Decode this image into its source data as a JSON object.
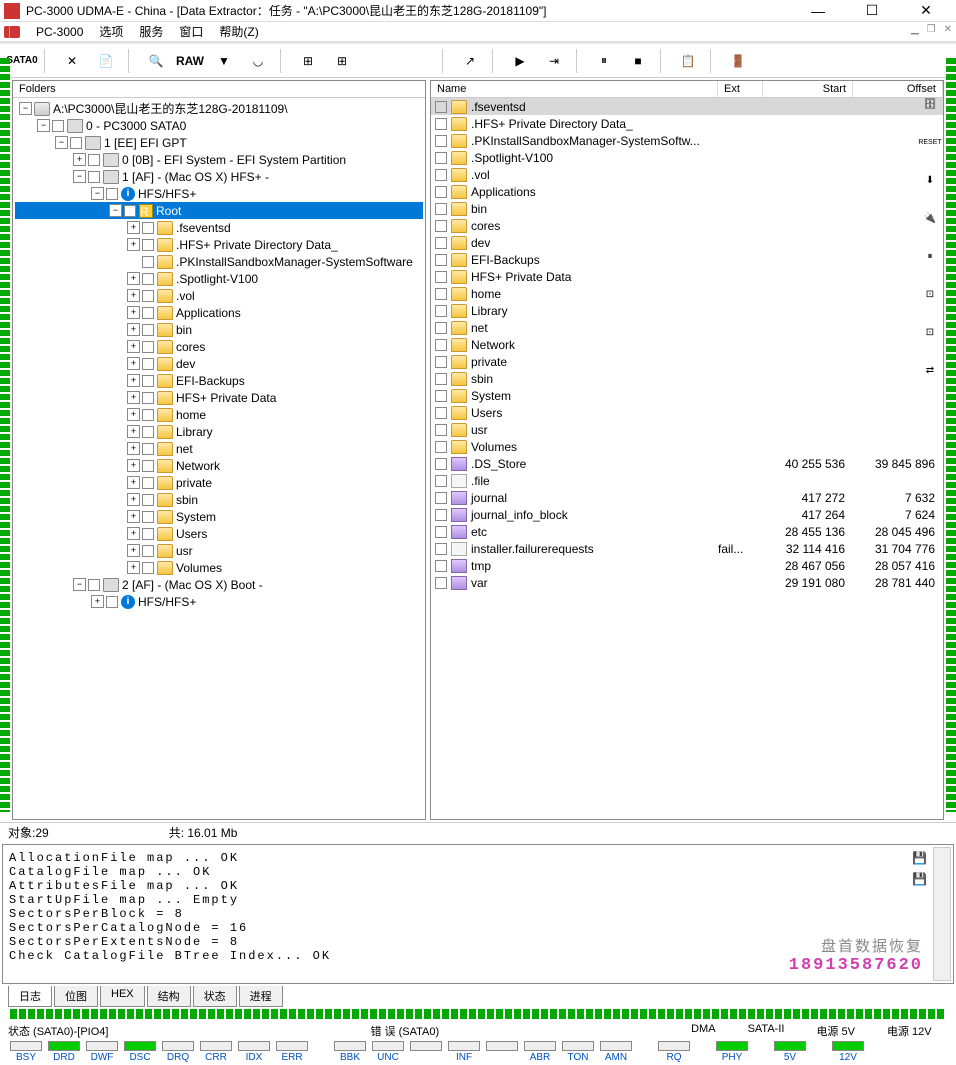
{
  "window": {
    "title": "PC-3000 UDMA-E - China - [Data Extractor：任务 - \"A:\\PC3000\\昆山老王的东芝128G-20181109\"]"
  },
  "menubar": {
    "app": "PC-3000",
    "items": [
      "选项",
      "服务",
      "窗口",
      "帮助(Z)"
    ]
  },
  "toolbar": {
    "sata": "SATA0",
    "raw": "RAW"
  },
  "folders": {
    "header": "Folders",
    "tree": [
      {
        "indent": 0,
        "exp": "min",
        "chk": false,
        "icon": "drive",
        "label": "A:\\PC3000\\昆山老王的东芝128G-20181109\\"
      },
      {
        "indent": 1,
        "exp": "min",
        "chk": true,
        "icon": "disk",
        "label": "0 - PC3000 SATA0"
      },
      {
        "indent": 2,
        "exp": "min",
        "chk": true,
        "icon": "disk",
        "label": "1 [EE] EFI GPT",
        "badge": "red"
      },
      {
        "indent": 3,
        "exp": "plus",
        "chk": true,
        "icon": "disk",
        "label": "0 [0B] - EFI System - EFI System Partition"
      },
      {
        "indent": 3,
        "exp": "min",
        "chk": true,
        "icon": "disk",
        "label": "1 [AF] - (Mac OS X) HFS+ -"
      },
      {
        "indent": 4,
        "exp": "min",
        "chk": true,
        "icon": "info",
        "label": "HFS/HFS+"
      },
      {
        "indent": 5,
        "exp": "min",
        "chk": true,
        "icon": "root",
        "label": "Root",
        "selected": true
      },
      {
        "indent": 6,
        "exp": "plus",
        "chk": true,
        "icon": "folder",
        "label": ".fseventsd"
      },
      {
        "indent": 6,
        "exp": "plus",
        "chk": true,
        "icon": "folder",
        "label": ".HFS+ Private Directory Data_"
      },
      {
        "indent": 6,
        "exp": "none",
        "chk": true,
        "icon": "folder",
        "label": ".PKInstallSandboxManager-SystemSoftware"
      },
      {
        "indent": 6,
        "exp": "plus",
        "chk": true,
        "icon": "folder",
        "label": ".Spotlight-V100"
      },
      {
        "indent": 6,
        "exp": "plus",
        "chk": true,
        "icon": "folder",
        "label": ".vol"
      },
      {
        "indent": 6,
        "exp": "plus",
        "chk": true,
        "icon": "folder",
        "label": "Applications"
      },
      {
        "indent": 6,
        "exp": "plus",
        "chk": true,
        "icon": "folder",
        "label": "bin"
      },
      {
        "indent": 6,
        "exp": "plus",
        "chk": true,
        "icon": "folder",
        "label": "cores"
      },
      {
        "indent": 6,
        "exp": "plus",
        "chk": true,
        "icon": "folder",
        "label": "dev"
      },
      {
        "indent": 6,
        "exp": "plus",
        "chk": true,
        "icon": "folder",
        "label": "EFI-Backups"
      },
      {
        "indent": 6,
        "exp": "plus",
        "chk": true,
        "icon": "folder",
        "label": "HFS+ Private Data"
      },
      {
        "indent": 6,
        "exp": "plus",
        "chk": true,
        "icon": "folder",
        "label": "home"
      },
      {
        "indent": 6,
        "exp": "plus",
        "chk": true,
        "icon": "folder",
        "label": "Library"
      },
      {
        "indent": 6,
        "exp": "plus",
        "chk": true,
        "icon": "folder",
        "label": "net"
      },
      {
        "indent": 6,
        "exp": "plus",
        "chk": true,
        "icon": "folder",
        "label": "Network"
      },
      {
        "indent": 6,
        "exp": "plus",
        "chk": true,
        "icon": "folder",
        "label": "private"
      },
      {
        "indent": 6,
        "exp": "plus",
        "chk": true,
        "icon": "folder",
        "label": "sbin"
      },
      {
        "indent": 6,
        "exp": "plus",
        "chk": true,
        "icon": "folder",
        "label": "System"
      },
      {
        "indent": 6,
        "exp": "plus",
        "chk": true,
        "icon": "folder",
        "label": "Users"
      },
      {
        "indent": 6,
        "exp": "plus",
        "chk": true,
        "icon": "folder",
        "label": "usr"
      },
      {
        "indent": 6,
        "exp": "plus",
        "chk": true,
        "icon": "folder",
        "label": "Volumes"
      },
      {
        "indent": 3,
        "exp": "min",
        "chk": true,
        "icon": "disk",
        "label": "2 [AF] - (Mac OS X) Boot -"
      },
      {
        "indent": 4,
        "exp": "plus",
        "chk": true,
        "icon": "info",
        "label": "HFS/HFS+"
      }
    ]
  },
  "list": {
    "headers": {
      "name": "Name",
      "ext": "Ext",
      "start": "Start",
      "offset": "Offset"
    },
    "rows": [
      {
        "icon": "folder",
        "name": ".fseventsd",
        "ext": "",
        "start": "",
        "offset": "",
        "selected": true
      },
      {
        "icon": "folder",
        "name": ".HFS+ Private Directory Data_",
        "ext": "",
        "start": "",
        "offset": ""
      },
      {
        "icon": "folder",
        "name": ".PKInstallSandboxManager-SystemSoftw...",
        "ext": "",
        "start": "",
        "offset": ""
      },
      {
        "icon": "folder",
        "name": ".Spotlight-V100",
        "ext": "",
        "start": "",
        "offset": ""
      },
      {
        "icon": "folder",
        "name": ".vol",
        "ext": "",
        "start": "",
        "offset": ""
      },
      {
        "icon": "folder",
        "name": "Applications",
        "ext": "",
        "start": "",
        "offset": ""
      },
      {
        "icon": "folder",
        "name": "bin",
        "ext": "",
        "start": "",
        "offset": ""
      },
      {
        "icon": "folder",
        "name": "cores",
        "ext": "",
        "start": "",
        "offset": ""
      },
      {
        "icon": "folder",
        "name": "dev",
        "ext": "",
        "start": "",
        "offset": ""
      },
      {
        "icon": "folder",
        "name": "EFI-Backups",
        "ext": "",
        "start": "",
        "offset": ""
      },
      {
        "icon": "folder",
        "name": "HFS+ Private Data",
        "ext": "",
        "start": "",
        "offset": ""
      },
      {
        "icon": "folder",
        "name": "home",
        "ext": "",
        "start": "",
        "offset": ""
      },
      {
        "icon": "folder",
        "name": "Library",
        "ext": "",
        "start": "",
        "offset": ""
      },
      {
        "icon": "folder",
        "name": "net",
        "ext": "",
        "start": "",
        "offset": ""
      },
      {
        "icon": "folder",
        "name": "Network",
        "ext": "",
        "start": "",
        "offset": ""
      },
      {
        "icon": "folder",
        "name": "private",
        "ext": "",
        "start": "",
        "offset": ""
      },
      {
        "icon": "folder",
        "name": "sbin",
        "ext": "",
        "start": "",
        "offset": ""
      },
      {
        "icon": "folder",
        "name": "System",
        "ext": "",
        "start": "",
        "offset": ""
      },
      {
        "icon": "folder",
        "name": "Users",
        "ext": "",
        "start": "",
        "offset": ""
      },
      {
        "icon": "folder",
        "name": "usr",
        "ext": "",
        "start": "",
        "offset": ""
      },
      {
        "icon": "folder",
        "name": "Volumes",
        "ext": "",
        "start": "",
        "offset": ""
      },
      {
        "icon": "special",
        "name": ".DS_Store",
        "ext": "",
        "start": "40 255 536",
        "offset": "39 845 896"
      },
      {
        "icon": "file",
        "name": ".file",
        "ext": "",
        "start": "",
        "offset": ""
      },
      {
        "icon": "special",
        "name": "journal",
        "ext": "",
        "start": "417 272",
        "offset": "7 632"
      },
      {
        "icon": "special",
        "name": "journal_info_block",
        "ext": "",
        "start": "417 264",
        "offset": "7 624"
      },
      {
        "icon": "special",
        "name": "etc",
        "ext": "",
        "start": "28 455 136",
        "offset": "28 045 496"
      },
      {
        "icon": "file",
        "name": "installer.failurerequests",
        "ext": "fail...",
        "start": "32 114 416",
        "offset": "31 704 776"
      },
      {
        "icon": "special",
        "name": "tmp",
        "ext": "",
        "start": "28 467 056",
        "offset": "28 057 416"
      },
      {
        "icon": "special",
        "name": "var",
        "ext": "",
        "start": "29 191 080",
        "offset": "28 781 440"
      }
    ]
  },
  "status": {
    "objects": "对象:29",
    "total": "共:   16.01 Mb"
  },
  "log": {
    "lines": [
      "AllocationFile map  ...  OK",
      "CatalogFile map     ...  OK",
      "AttributesFile map  ...  OK",
      "StartUpFile map     ...  Empty",
      "SectorsPerBlock        = 8",
      "SectorsPerCatalogNode  = 16",
      "SectorsPerExtentsNode  = 8",
      "Check CatalogFile BTree Index...  OK"
    ],
    "tabs": [
      "日志",
      "位图",
      "HEX",
      "结构",
      "状态",
      "进程"
    ]
  },
  "watermark": {
    "text": "盘首数据恢复",
    "phone": "18913587620"
  },
  "bottom": {
    "groups": [
      "状态 (SATA0)-[PIO4]",
      "错 误 (SATA0)",
      "DMA",
      "SATA-II",
      "电源 5V",
      "电源 12V"
    ],
    "indicators": [
      {
        "label": "BSY",
        "on": false
      },
      {
        "label": "DRD",
        "on": true
      },
      {
        "label": "DWF",
        "on": false
      },
      {
        "label": "DSC",
        "on": true
      },
      {
        "label": "DRQ",
        "on": false
      },
      {
        "label": "CRR",
        "on": false
      },
      {
        "label": "IDX",
        "on": false
      },
      {
        "label": "ERR",
        "on": false
      },
      {
        "gap": true
      },
      {
        "label": "BBK",
        "on": false
      },
      {
        "label": "UNC",
        "on": false
      },
      {
        "label": "",
        "on": false
      },
      {
        "label": "INF",
        "on": false
      },
      {
        "label": "",
        "on": false
      },
      {
        "label": "ABR",
        "on": false
      },
      {
        "label": "TON",
        "on": false
      },
      {
        "label": "AMN",
        "on": false
      },
      {
        "gap": true
      },
      {
        "label": "RQ",
        "on": false
      },
      {
        "gap": true
      },
      {
        "label": "PHY",
        "on": true
      },
      {
        "gap": true
      },
      {
        "label": "5V",
        "on": true
      },
      {
        "gap": true
      },
      {
        "label": "12V",
        "on": true
      }
    ]
  },
  "right_toolbar": {
    "reset": "RESET"
  }
}
